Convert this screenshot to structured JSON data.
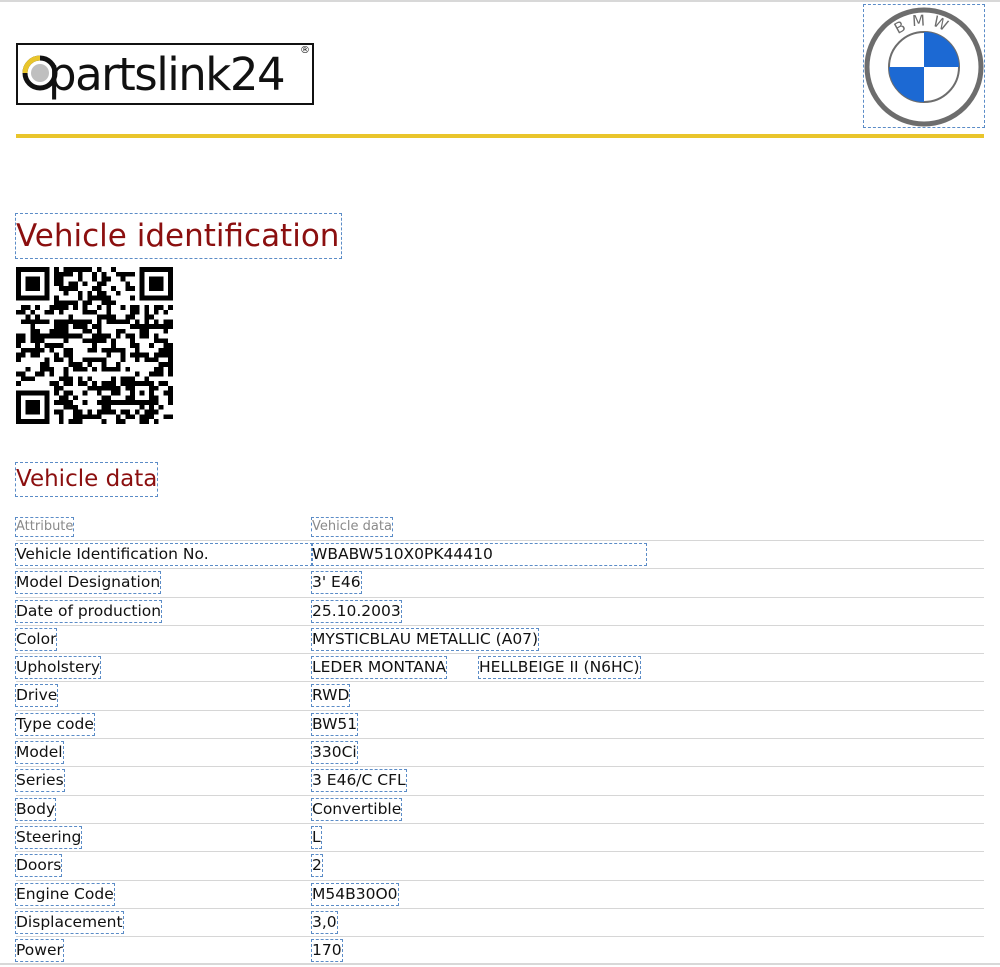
{
  "header": {
    "brand_wordmark": "partslink24",
    "brand_registered": "®",
    "make_logo_letters": "BMW",
    "colors": {
      "rule": "#e9c52b",
      "heading": "#8b0f0f",
      "bmw_blue": "#1c69d3"
    }
  },
  "sections": {
    "identification_title": "Vehicle identification",
    "vehicle_data_title": "Vehicle data"
  },
  "table": {
    "columns": [
      "Attribute",
      "Vehicle data"
    ],
    "rows": [
      {
        "attribute": "Vehicle Identification No.",
        "value": "WBABW510X0PK44410"
      },
      {
        "attribute": "Model Designation",
        "value": "3' E46"
      },
      {
        "attribute": "Date of production",
        "value": "25.10.2003"
      },
      {
        "attribute": "Color",
        "value": "MYSTICBLAU METALLIC (A07)"
      },
      {
        "attribute": "Upholstery",
        "value": "LEDER MONTANA",
        "value2": "HELLBEIGE II (N6HC)"
      },
      {
        "attribute": "Drive",
        "value": "RWD"
      },
      {
        "attribute": "Type code",
        "value": "BW51"
      },
      {
        "attribute": "Model",
        "value": "330Ci"
      },
      {
        "attribute": "Series",
        "value": "3 E46/C CFL"
      },
      {
        "attribute": "Body",
        "value": "Convertible"
      },
      {
        "attribute": "Steering",
        "value": "L"
      },
      {
        "attribute": "Doors",
        "value": "2"
      },
      {
        "attribute": "Engine Code",
        "value": "M54B30O0"
      },
      {
        "attribute": "Displacement",
        "value": "3,0"
      },
      {
        "attribute": "Power",
        "value": "170"
      }
    ]
  }
}
